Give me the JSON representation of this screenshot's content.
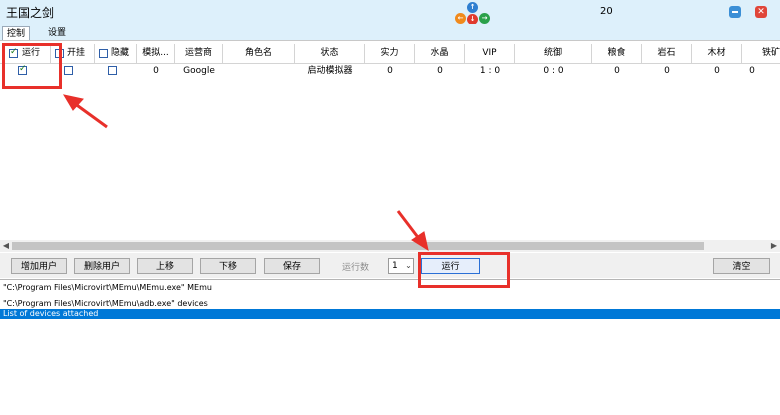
{
  "window": {
    "title": "王国之剑",
    "counter": "20",
    "close_glyph": "✕"
  },
  "nav_arrows": {
    "up": "↑",
    "left": "←",
    "right": "→",
    "down": "↓"
  },
  "tabs": [
    {
      "label": "控制"
    },
    {
      "label": "设置"
    }
  ],
  "grid": {
    "headers": [
      "运行",
      "开挂",
      "隐藏",
      "模拟...",
      "运营商",
      "角色名",
      "状态",
      "实力",
      "水晶",
      "VIP",
      "统御",
      "粮食",
      "岩石",
      "木材",
      "铁矿"
    ],
    "row": {
      "run_checked": true,
      "emulator_id": "0",
      "operator": "Google",
      "role_name": "",
      "status": "启动模拟器",
      "power": "0",
      "crystal": "0",
      "vip": "1 : 0",
      "command": "0 : 0",
      "food": "0",
      "stone": "0",
      "wood": "0",
      "iron": "0"
    }
  },
  "toolbar": {
    "add_user": "增加用户",
    "delete_user": "删除用户",
    "move_up": "上移",
    "move_down": "下移",
    "save": "保存",
    "run_count_label": "运行数",
    "run_count_value": "1",
    "run": "运行",
    "clear": "清空"
  },
  "log": [
    "\"C:\\Program Files\\Microvirt\\MEmu\\MEmu.exe\" MEmu",
    "",
    "\"C:\\Program Files\\Microvirt\\MEmu\\adb.exe\" devices",
    "List of devices attached"
  ],
  "colors": {
    "accent": "#0078d7",
    "annotation": "#e8302a",
    "titlebar": "#ddf0fb"
  }
}
